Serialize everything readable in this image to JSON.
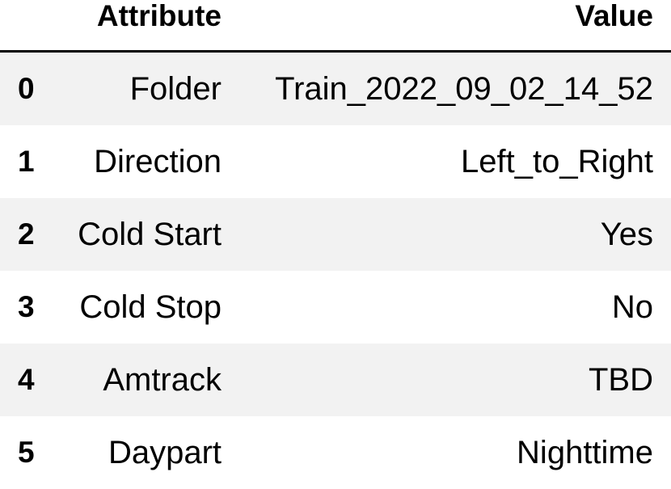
{
  "table": {
    "headers": {
      "attribute": "Attribute",
      "value": "Value"
    },
    "rows": [
      {
        "index": "0",
        "attribute": "Folder",
        "value": "Train_2022_09_02_14_52"
      },
      {
        "index": "1",
        "attribute": "Direction",
        "value": "Left_to_Right"
      },
      {
        "index": "2",
        "attribute": "Cold Start",
        "value": "Yes"
      },
      {
        "index": "3",
        "attribute": "Cold Stop",
        "value": "No"
      },
      {
        "index": "4",
        "attribute": "Amtrack",
        "value": "TBD"
      },
      {
        "index": "5",
        "attribute": "Daypart",
        "value": "Nighttime"
      }
    ]
  },
  "colors": {
    "stripe": "#f2f2f2",
    "background": "#ffffff",
    "text": "#000000",
    "header_rule": "#000000"
  }
}
